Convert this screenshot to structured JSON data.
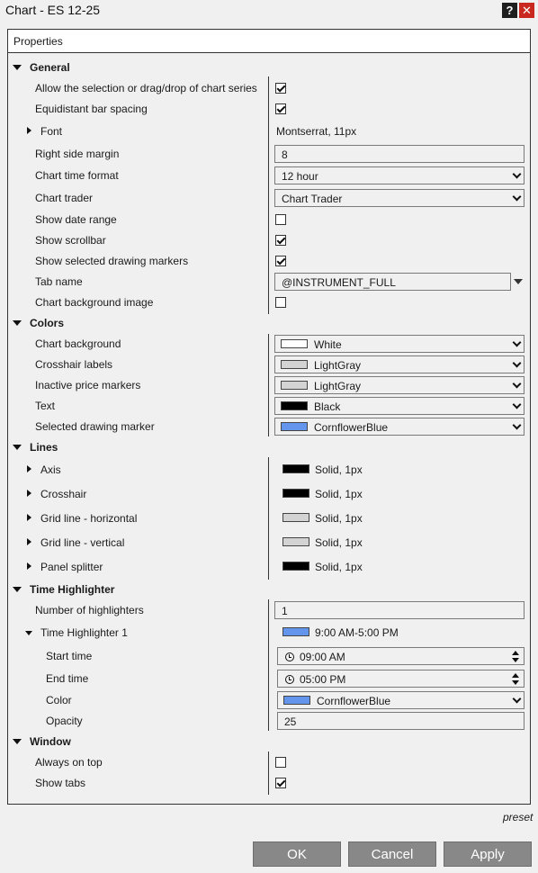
{
  "window": {
    "title": "Chart - ES 12-25",
    "help_label": "?",
    "close_label": "✕"
  },
  "panel_header": "Properties",
  "general": {
    "section": "General",
    "allow_selection": {
      "label": "Allow the selection or drag/drop of chart series",
      "checked": true
    },
    "equidistant": {
      "label": "Equidistant bar spacing",
      "checked": true
    },
    "font": {
      "label": "Font",
      "value": "Montserrat, 11px"
    },
    "right_margin": {
      "label": "Right side margin",
      "value": "8"
    },
    "time_format": {
      "label": "Chart time format",
      "value": "12 hour"
    },
    "chart_trader": {
      "label": "Chart trader",
      "value": "Chart Trader"
    },
    "date_range": {
      "label": "Show date range",
      "checked": false
    },
    "scrollbar": {
      "label": "Show scrollbar",
      "checked": true
    },
    "drawing_markers": {
      "label": "Show selected drawing markers",
      "checked": true
    },
    "tab_name": {
      "label": "Tab name",
      "value": "@INSTRUMENT_FULL"
    },
    "bg_image": {
      "label": "Chart background image",
      "checked": false
    }
  },
  "colors": {
    "section": "Colors",
    "chart_bg": {
      "label": "Chart background",
      "value": "White",
      "color": "#ffffff"
    },
    "crosshair_labels": {
      "label": "Crosshair labels",
      "value": "LightGray",
      "color": "#d3d3d3"
    },
    "inactive_markers": {
      "label": "Inactive price markers",
      "value": "LightGray",
      "color": "#d3d3d3"
    },
    "text": {
      "label": "Text",
      "value": "Black",
      "color": "#000000"
    },
    "selected_marker": {
      "label": "Selected drawing marker",
      "value": "CornflowerBlue",
      "color": "#6495ed"
    }
  },
  "lines": {
    "section": "Lines",
    "axis": {
      "label": "Axis",
      "value": "Solid, 1px",
      "color": "#000000"
    },
    "crosshair": {
      "label": "Crosshair",
      "value": "Solid, 1px",
      "color": "#000000"
    },
    "grid_h": {
      "label": "Grid line - horizontal",
      "value": "Solid, 1px",
      "color": "#d3d3d3"
    },
    "grid_v": {
      "label": "Grid line - vertical",
      "value": "Solid, 1px",
      "color": "#d3d3d3"
    },
    "panel_splitter": {
      "label": "Panel splitter",
      "value": "Solid, 1px",
      "color": "#000000"
    }
  },
  "time_highlighter": {
    "section": "Time Highlighter",
    "count": {
      "label": "Number of highlighters",
      "value": "1"
    },
    "item1": {
      "label": "Time Highlighter 1",
      "value": "9:00 AM-5:00 PM",
      "color": "#6495ed"
    },
    "start": {
      "label": "Start time",
      "value": "09:00 AM"
    },
    "end": {
      "label": "End time",
      "value": "05:00 PM"
    },
    "color": {
      "label": "Color",
      "value": "CornflowerBlue",
      "color": "#6495ed"
    },
    "opacity": {
      "label": "Opacity",
      "value": "25"
    }
  },
  "window_section": {
    "section": "Window",
    "always_on_top": {
      "label": "Always on top",
      "checked": false
    },
    "show_tabs": {
      "label": "Show tabs",
      "checked": true
    }
  },
  "footer": {
    "preset": "preset",
    "ok": "OK",
    "cancel": "Cancel",
    "apply": "Apply"
  }
}
